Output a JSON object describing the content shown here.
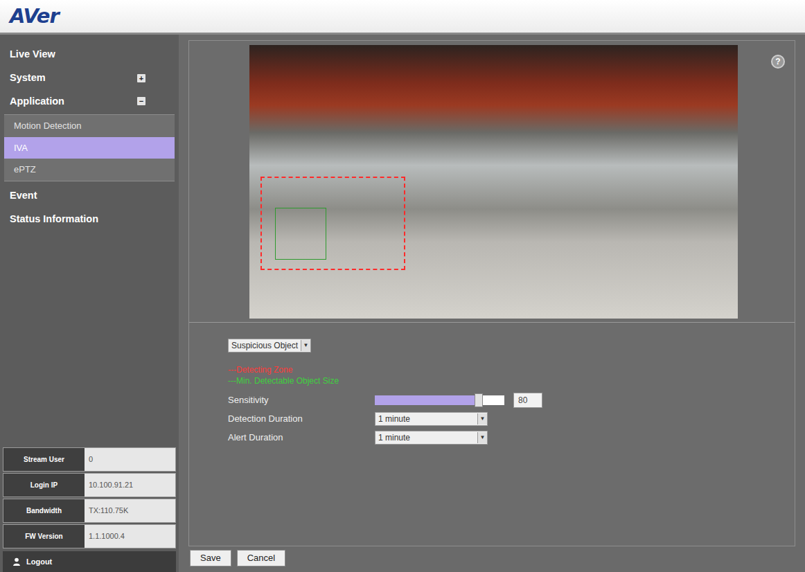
{
  "logo": {
    "text": "AVer"
  },
  "sidebar": {
    "items": [
      {
        "label": "Live View",
        "kind": "plain"
      },
      {
        "label": "System",
        "kind": "group",
        "toggle": "+",
        "expanded": false
      },
      {
        "label": "Application",
        "kind": "group",
        "toggle": "−",
        "expanded": true,
        "children": [
          {
            "label": "Motion Detection",
            "selected": false
          },
          {
            "label": "IVA",
            "selected": true
          },
          {
            "label": "ePTZ",
            "selected": false
          }
        ]
      },
      {
        "label": "Event",
        "kind": "plain"
      },
      {
        "label": "Status Information",
        "kind": "plain"
      }
    ],
    "info": [
      {
        "label": "Stream User",
        "value": "0"
      },
      {
        "label": "Login IP",
        "value": "10.100.91.21"
      },
      {
        "label": "Bandwidth",
        "value": "TX:110.75K"
      },
      {
        "label": "FW Version",
        "value": "1.1.1000.4"
      }
    ],
    "logout": "Logout"
  },
  "main": {
    "help": "?",
    "mode": "Suspicious Object",
    "legend": [
      {
        "label": "---Detecting Zone",
        "color": "#ff3b3b"
      },
      {
        "label": "---Min. Detectable Object Size",
        "color": "#3fd13f"
      }
    ],
    "fields": [
      {
        "label": "Sensitivity",
        "kind": "slider",
        "level": 0.8,
        "value": "80"
      },
      {
        "label": "Detection Duration",
        "kind": "select",
        "value": "1 minute"
      },
      {
        "label": "Alert Duration",
        "kind": "select",
        "value": "1 minute"
      }
    ]
  },
  "buttons": [
    "Save",
    "Cancel"
  ]
}
